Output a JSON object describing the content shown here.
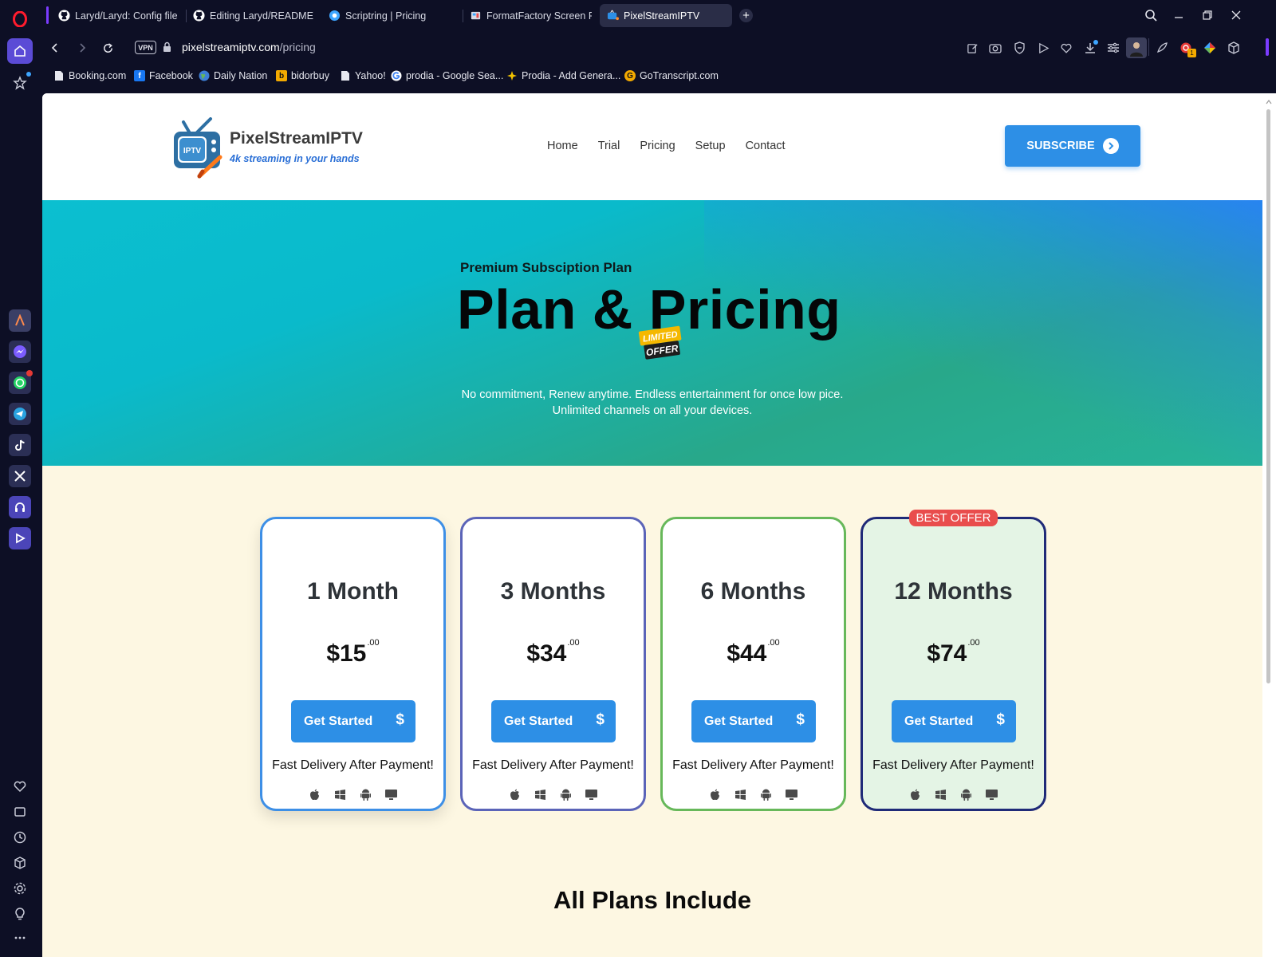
{
  "tabs": [
    {
      "title": "Laryd/Laryd: Config files fo",
      "favicon": "github-icon"
    },
    {
      "title": "Editing Laryd/README.md",
      "favicon": "github-icon"
    },
    {
      "title": "Scriptring | Pricing",
      "favicon": "scriptring-icon"
    },
    {
      "title": "FormatFactory Screen Rec",
      "favicon": "formatfactory-icon"
    },
    {
      "title": "PixelStreamIPTV",
      "favicon": "tv-icon",
      "active": true
    }
  ],
  "address": {
    "vpn_label": "VPN",
    "host": "pixelstreamiptv.com",
    "path": "/pricing"
  },
  "bookmarks": [
    {
      "label": "Booking.com"
    },
    {
      "label": "Facebook"
    },
    {
      "label": "Daily Nation"
    },
    {
      "label": "bidorbuy"
    },
    {
      "label": "Yahoo!"
    },
    {
      "label": "prodia - Google Sea..."
    },
    {
      "label": "Prodia - Add Genera..."
    },
    {
      "label": "GoTranscript.com"
    }
  ],
  "site": {
    "brand": "PixelStreamIPTV",
    "tagline": "4k streaming in your hands",
    "logo_text": "IPTV",
    "nav": [
      "Home",
      "Trial",
      "Pricing",
      "Setup",
      "Contact"
    ],
    "subscribe_label": "SUBSCRIBE"
  },
  "hero": {
    "kicker": "Premium Subsciption Plan",
    "title": "Plan & Pricing",
    "limited_badge_top": "LIMITED",
    "limited_badge_bottom": "OFFER",
    "subtitle_line1": "No commitment, Renew anytime. Endless entertainment for once low pice.",
    "subtitle_line2": "Unlimited channels on all your devices."
  },
  "plans": [
    {
      "title": "1 Month",
      "price": "$15",
      "cents": ".00",
      "cta": "Get Started",
      "note": "Fast Delivery After Payment!",
      "border_color": "#3d8fe6"
    },
    {
      "title": "3 Months",
      "price": "$34",
      "cents": ".00",
      "cta": "Get Started",
      "note": "Fast Delivery After Payment!",
      "border_color": "#5b64b8"
    },
    {
      "title": "6 Months",
      "price": "$44",
      "cents": ".00",
      "cta": "Get Started",
      "note": "Fast Delivery After Payment!",
      "border_color": "#67b85a"
    },
    {
      "title": "12 Months",
      "price": "$74",
      "cents": ".00",
      "cta": "Get Started",
      "note": "Fast Delivery After Payment!",
      "border_color": "#1f2a78",
      "badge": "BEST OFFER"
    }
  ],
  "device_icons": [
    "apple-icon",
    "windows-icon",
    "android-icon",
    "tv-monitor-icon"
  ],
  "section_title": "All Plans Include",
  "colors": {
    "accent_blue": "#2d8fe6",
    "badge_red": "#e94d4d",
    "plans_bg": "#fdf7e2"
  }
}
